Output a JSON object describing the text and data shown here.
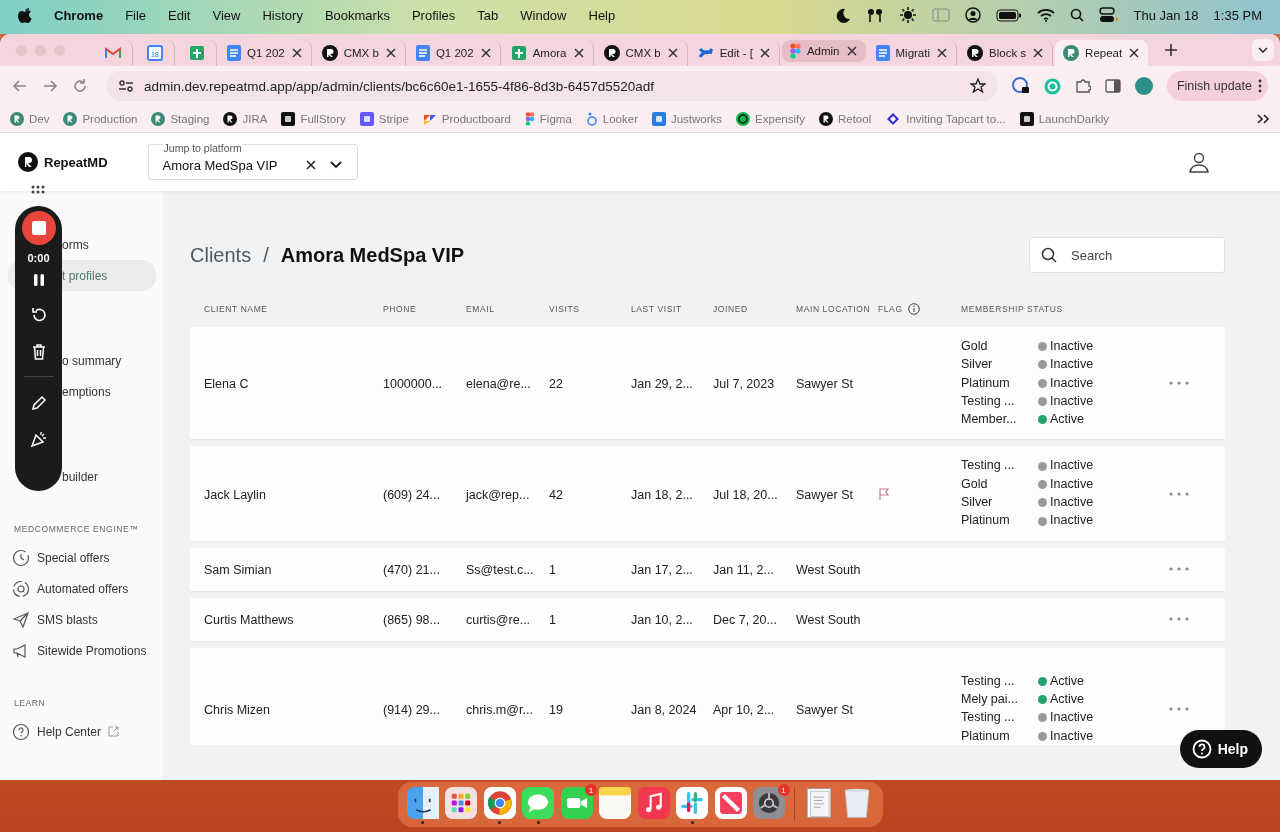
{
  "menu_bar": {
    "app": "Chrome",
    "menus": [
      "File",
      "Edit",
      "View",
      "History",
      "Bookmarks",
      "Profiles",
      "Tab",
      "Window",
      "Help"
    ],
    "date": "Thu Jan 18",
    "time": "1:35 PM"
  },
  "browser": {
    "tabs": [
      {
        "kind": "pinned",
        "selected": false,
        "hovered": false
      },
      {
        "kind": "pinned",
        "icon_text": "18",
        "selected": false,
        "hovered": false
      },
      {
        "kind": "pinned",
        "selected": false,
        "hovered": false
      },
      {
        "kind": "tab",
        "title": "Q1 202",
        "selected": false,
        "hovered": false
      },
      {
        "kind": "tab",
        "title": "CMX b",
        "selected": false,
        "hovered": false
      },
      {
        "kind": "tab",
        "title": "Q1 202",
        "selected": false,
        "hovered": false
      },
      {
        "kind": "tab",
        "title": "Amora",
        "selected": false,
        "hovered": false
      },
      {
        "kind": "tab",
        "title": "CMX b",
        "selected": false,
        "hovered": false
      },
      {
        "kind": "tab",
        "title": "Edit - [",
        "selected": false,
        "hovered": false
      },
      {
        "kind": "tab",
        "title": "Admin",
        "selected": false,
        "hovered": true
      },
      {
        "kind": "tab",
        "title": "Migrati",
        "selected": false,
        "hovered": false
      },
      {
        "kind": "tab",
        "title": "Block s",
        "selected": false,
        "hovered": false
      },
      {
        "kind": "tab",
        "title": "Repeat",
        "selected": true,
        "hovered": false
      }
    ],
    "url": "admin.dev.repeatmd.app/app/admin/clients/bc6c60e1-1655-4f86-8d3b-6457d5520adf",
    "update_button": "Finish update",
    "bookmarks": [
      "Dev",
      "Production",
      "Staging",
      "JIRA",
      "FullStory",
      "Stripe",
      "Productboard",
      "Figma",
      "Looker",
      "Justworks",
      "Expensify",
      "Retool",
      "Inviting Tapcart to...",
      "LaunchDarkly"
    ]
  },
  "app": {
    "brand": "RepeatMD",
    "platform_picker": {
      "label": "Jump to platform",
      "value": "Amora MedSpa VIP"
    },
    "sidebar": {
      "sections": [
        {
          "items": [
            {
              "kind": "covered",
              "label": "orms",
              "selected": false
            },
            {
              "kind": "covered",
              "label": "t profiles",
              "selected": true
            }
          ]
        },
        {
          "items": [
            {
              "kind": "covered",
              "label": "o summary",
              "selected": false
            },
            {
              "kind": "covered",
              "label": "emptions",
              "selected": false
            }
          ]
        },
        {
          "items": [
            {
              "kind": "covered",
              "label": "builder",
              "selected": false
            }
          ]
        },
        {
          "title": "MEDCOMMERCE ENGINE™",
          "items": [
            {
              "kind": "link",
              "label": "Special offers",
              "selected": false
            },
            {
              "kind": "link",
              "label": "Automated offers",
              "selected": false
            },
            {
              "kind": "link",
              "label": "SMS blasts",
              "selected": false
            },
            {
              "kind": "link",
              "label": "Sitewide Promotions",
              "selected": false
            }
          ]
        },
        {
          "title": "LEARN",
          "items": [
            {
              "kind": "link",
              "label": "Help Center",
              "selected": false,
              "external": true
            }
          ]
        }
      ]
    },
    "recorder": {
      "timer": "0:00"
    },
    "breadcrumb": {
      "parent": "Clients",
      "separator": "/",
      "current": "Amora MedSpa VIP"
    },
    "search": {
      "placeholder": "Search"
    },
    "table": {
      "columns": [
        {
          "label": "CLIENT NAME",
          "info": false
        },
        {
          "label": "PHONE",
          "info": false
        },
        {
          "label": "EMAIL",
          "info": false
        },
        {
          "label": "VISITS",
          "info": false
        },
        {
          "label": "LAST VISIT",
          "info": false
        },
        {
          "label": "JOINED",
          "info": false
        },
        {
          "label": "MAIN LOCATION",
          "info": false
        },
        {
          "label": "FLAG",
          "info": true
        },
        {
          "label": "MEMBERSHIP STATUS",
          "info": false
        }
      ],
      "rows": [
        {
          "name": "Elena C",
          "phone": "1000000...",
          "email": "elena@re...",
          "visits": "22",
          "last_visit": "Jan 29, 2...",
          "joined": "Jul 7, 2023",
          "location": "Sawyer St",
          "flagged": false,
          "memberships": [
            {
              "name": "Gold",
              "status": "Inactive",
              "color": "#9a9a9e"
            },
            {
              "name": "Silver",
              "status": "Inactive",
              "color": "#9a9a9e"
            },
            {
              "name": "Platinum",
              "status": "Inactive",
              "color": "#9a9a9e"
            },
            {
              "name": "Testing ...",
              "status": "Inactive",
              "color": "#9a9a9e"
            },
            {
              "name": "Member...",
              "status": "Active",
              "color": "#23a26d"
            }
          ]
        },
        {
          "name": "Jack Laylin",
          "phone": "(609) 24...",
          "email": "jack@rep...",
          "visits": "42",
          "last_visit": "Jan 18, 2...",
          "joined": "Jul 18, 20...",
          "location": "Sawyer St",
          "flagged": true,
          "memberships": [
            {
              "name": "Testing ...",
              "status": "Inactive",
              "color": "#9a9a9e"
            },
            {
              "name": "Gold",
              "status": "Inactive",
              "color": "#9a9a9e"
            },
            {
              "name": "Silver",
              "status": "Inactive",
              "color": "#9a9a9e"
            },
            {
              "name": "Platinum",
              "status": "Inactive",
              "color": "#9a9a9e"
            }
          ]
        },
        {
          "name": "Sam Simian",
          "phone": "(470) 21...",
          "email": "Ss@test.c...",
          "visits": "1",
          "last_visit": "Jan 17, 2...",
          "joined": "Jan 11, 2...",
          "location": "West South",
          "flagged": false
        },
        {
          "name": "Curtis Matthews",
          "phone": "(865) 98...",
          "email": "curtis@re...",
          "visits": "1",
          "last_visit": "Jan 10, 2...",
          "joined": "Dec 7, 20...",
          "location": "West South",
          "flagged": false
        },
        {
          "name": "Chris Mizen",
          "phone": "(914) 29...",
          "email": "chris.m@r...",
          "visits": "19",
          "last_visit": "Jan 8, 2024",
          "joined": "Apr 10, 2...",
          "location": "Sawyer St",
          "flagged": false,
          "memberships": [
            {
              "name": "Testing ...",
              "status": "Active",
              "color": "#23a26d"
            },
            {
              "name": "Mely pai...",
              "status": "Active",
              "color": "#23a26d"
            },
            {
              "name": "Testing ...",
              "status": "Inactive",
              "color": "#9a9a9e"
            },
            {
              "name": "Platinum",
              "status": "Inactive",
              "color": "#9a9a9e"
            }
          ]
        }
      ]
    },
    "help_button": "Help"
  },
  "dock": {
    "apps": [
      {
        "running": true
      },
      {
        "running": false
      },
      {
        "running": true
      },
      {
        "running": true
      },
      {
        "running": false,
        "badge": "1"
      },
      {
        "running": false
      },
      {
        "running": false
      },
      {
        "running": true
      },
      {
        "running": false
      },
      {
        "running": false,
        "badge": "1"
      },
      {
        "running": false
      },
      {
        "running": false
      }
    ]
  }
}
